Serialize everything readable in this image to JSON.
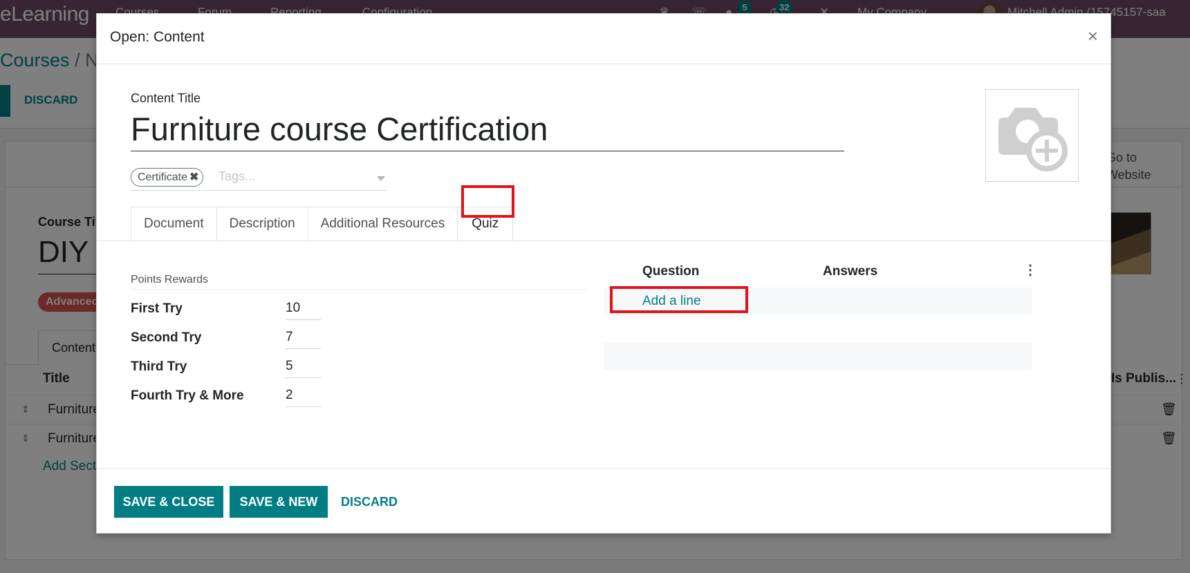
{
  "navbar": {
    "app_name": "eLearning",
    "menu": [
      "Courses",
      "Forum",
      "Reporting",
      "Configuration"
    ],
    "icons": [
      "bug-icon",
      "phone-icon",
      "chat-icon",
      "activity-icon",
      "tools-icon"
    ],
    "messages_badge": "5",
    "activities_badge": "32",
    "company": "My Company",
    "user": "Mitchell Admin (15745157-saa"
  },
  "background": {
    "breadcrumb_parent": "Courses",
    "breadcrumb_separator": "/",
    "breadcrumb_current": "New",
    "discard_label": "DISCARD",
    "website_button": [
      "Go to",
      "Website"
    ],
    "course_title_label": "Course Title",
    "course_title": "DIY",
    "level_tag": "Advanced",
    "content_tab": "Content",
    "columns": {
      "title": "Title",
      "published": "Is Publis..."
    },
    "rows": [
      {
        "title": "Furniture"
      },
      {
        "title": "Furniture"
      }
    ],
    "add_section": "Add Section"
  },
  "modal": {
    "title": "Open: Content",
    "close_icon": "×",
    "content_title_label": "Content Title",
    "content_title": "Furniture course Certification",
    "tags": [
      {
        "label": "Certificate"
      }
    ],
    "tags_placeholder": "Tags...",
    "tabs": [
      {
        "label": "Document",
        "active": false
      },
      {
        "label": "Description",
        "active": false
      },
      {
        "label": "Additional Resources",
        "active": false
      },
      {
        "label": "Quiz",
        "active": true
      }
    ],
    "quiz": {
      "points_rewards_title": "Points Rewards",
      "rewards": [
        {
          "label": "First Try",
          "value": "10"
        },
        {
          "label": "Second Try",
          "value": "7"
        },
        {
          "label": "Third Try",
          "value": "5"
        },
        {
          "label": "Fourth Try & More",
          "value": "2"
        }
      ],
      "columns": {
        "question": "Question",
        "answers": "Answers"
      },
      "add_line": "Add a line"
    },
    "footer": {
      "save_close": "SAVE & CLOSE",
      "save_new": "SAVE & NEW",
      "discard": "DISCARD"
    }
  },
  "colors": {
    "primary": "#017e84",
    "navbar": "#714b67",
    "highlight": "#e3121b",
    "tag_danger": "#d9534f"
  }
}
